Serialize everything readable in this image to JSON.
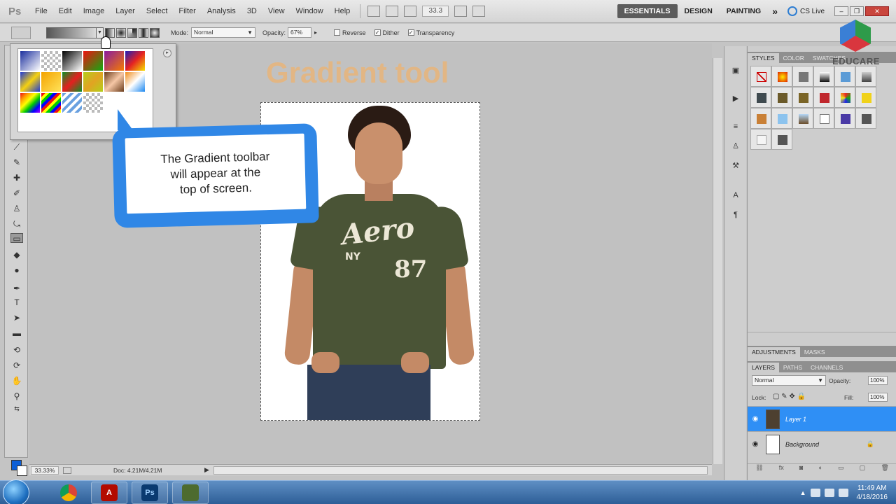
{
  "app": {
    "logo_text": "Ps"
  },
  "menu": [
    "File",
    "Edit",
    "Image",
    "Layer",
    "Select",
    "Filter",
    "Analysis",
    "3D",
    "View",
    "Window",
    "Help"
  ],
  "appbar": {
    "zoom": "33.3",
    "workspaces": [
      "ESSENTIALS",
      "DESIGN",
      "PAINTING"
    ],
    "more_workspaces": "»",
    "cslive": "CS Live"
  },
  "options": {
    "mode_label": "Mode:",
    "mode_value": "Normal",
    "opacity_label": "Opacity:",
    "opacity_value": "67%",
    "reverse_label": "Reverse",
    "dither_label": "Dither",
    "transparency_label": "Transparency"
  },
  "canvas": {
    "title": "Gradient tool",
    "shirt_text": "Aero",
    "shirt_sub": "NY",
    "shirt_num": "87"
  },
  "callout": {
    "text": "The Gradient toolbar\nwill appear at the\ntop of screen."
  },
  "status": {
    "zoom": "33.33%",
    "doc": "Doc: 4.21M/4.21M"
  },
  "panels": {
    "top_tabs": [
      "STYLES",
      "COLOR",
      "SWATCHES"
    ],
    "mid_tabs": [
      "ADJUSTMENTS",
      "MASKS"
    ],
    "layers_tabs": [
      "LAYERS",
      "PATHS",
      "CHANNELS"
    ],
    "blend_mode": "Normal",
    "opacity_label": "Opacity:",
    "opacity_value": "100%",
    "lock_label": "Lock:",
    "fill_label": "Fill:",
    "fill_value": "100%",
    "layers": [
      {
        "name": "Layer 1",
        "selected": true
      },
      {
        "name": "Background",
        "selected": false
      }
    ]
  },
  "logo": {
    "text": "EDUCARE"
  },
  "taskbar": {
    "apps": [
      "start-orb-icon",
      "chrome-icon",
      "acrobat-icon",
      "photoshop-icon",
      "app-icon"
    ],
    "time": "11:49 AM",
    "date": "4/18/2016"
  },
  "colors": {
    "accent": "#3087e6",
    "foreground": "#0d5fd6",
    "selection": "#2f8ff5"
  }
}
